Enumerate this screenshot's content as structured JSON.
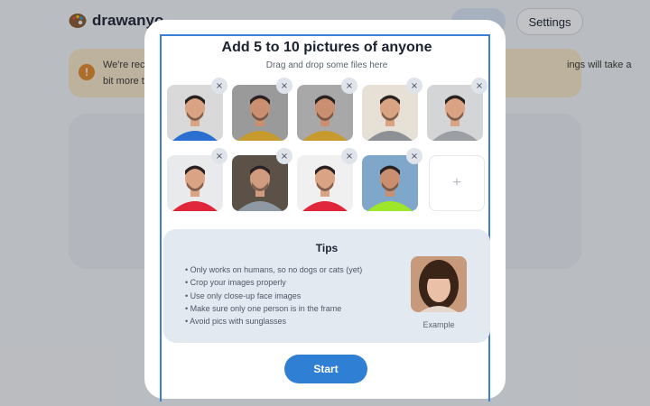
{
  "app": {
    "name": "drawanyo"
  },
  "header": {
    "settings_label": "Settings"
  },
  "notice": {
    "icon": "exclamation-icon",
    "line1": "We're rece",
    "line1_right": "ings will take a",
    "line2": "bit more ti"
  },
  "modal": {
    "title": "Add 5 to 10 pictures of anyone",
    "subtitle": "Drag and drop some files here",
    "remove_label": "×",
    "add_label": "+",
    "photos": [
      {
        "shirt": "#2b6fd0",
        "bg": "#d9d9d9",
        "skin": "#d9a384"
      },
      {
        "shirt": "#c69a2c",
        "bg": "#9a9a9a",
        "skin": "#c98f70"
      },
      {
        "shirt": "#c69a2c",
        "bg": "#a8a8a8",
        "skin": "#c98f70"
      },
      {
        "shirt": "#8d9196",
        "bg": "#e7e0d6",
        "skin": "#d9a384"
      },
      {
        "shirt": "#9b9fa3",
        "bg": "#d3d5d7",
        "skin": "#d9a384"
      },
      {
        "shirt": "#e0263a",
        "bg": "#e8eaeb",
        "skin": "#d9a384"
      },
      {
        "shirt": "#8e99a4",
        "bg": "#5b5147",
        "skin": "#cf9c80"
      },
      {
        "shirt": "#e0263a",
        "bg": "#f0f0f0",
        "skin": "#d9a384"
      },
      {
        "shirt": "#9ee62a",
        "bg": "#7fa7c9",
        "skin": "#c98f70"
      }
    ],
    "tips": {
      "title": "Tips",
      "items": [
        "Only works on humans, so no dogs or cats (yet)",
        "Crop your images properly",
        "Use only close-up face images",
        "Make sure only one person is in the frame",
        "Avoid pics with sunglasses"
      ],
      "example_caption": "Example"
    },
    "start_label": "Start"
  }
}
